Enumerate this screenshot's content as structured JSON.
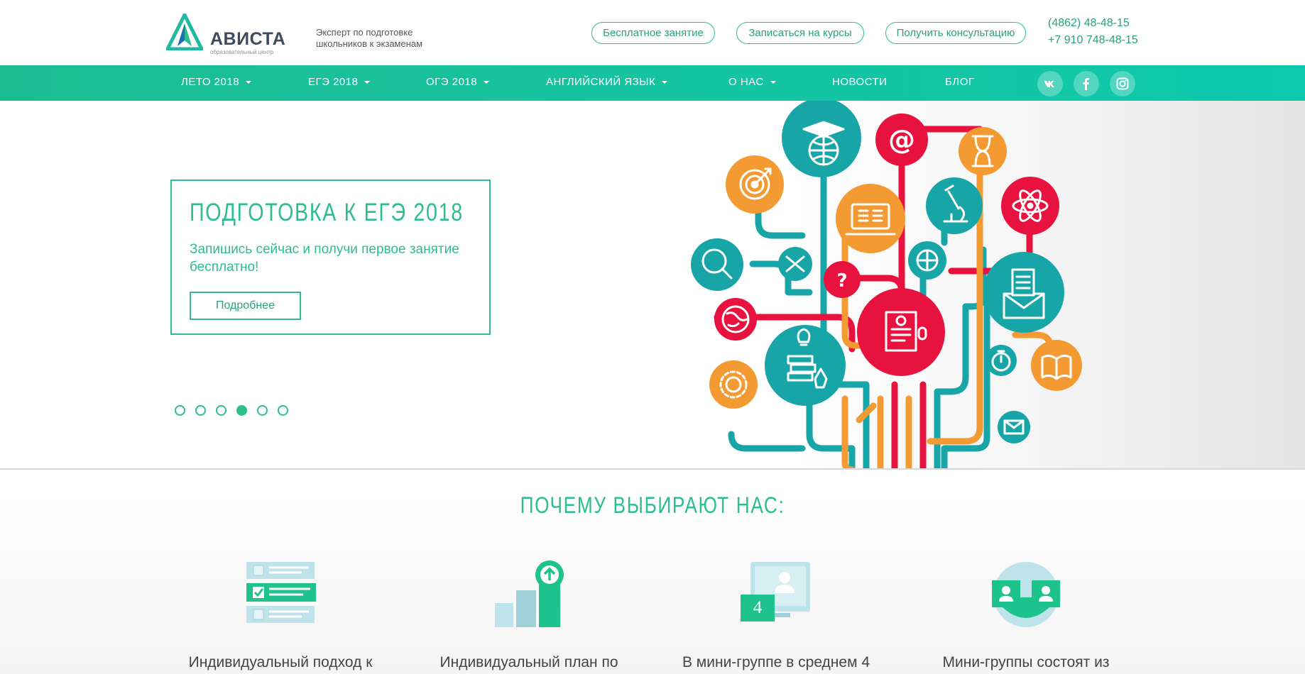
{
  "header": {
    "logo": {
      "name": "АВИСТА",
      "sub": "образовательный центр"
    },
    "tagline": "Эксперт по подготовке школьников к экзаменам",
    "buttons": {
      "free_lesson": "Бесплатное занятие",
      "enroll": "Записаться на курсы",
      "consult": "Получить консультацию"
    },
    "phones": [
      "(4862) 48-48-15",
      "+7 910 748-48-15"
    ]
  },
  "nav": {
    "items": [
      {
        "label": "ЛЕТО 2018",
        "dropdown": true
      },
      {
        "label": "ЕГЭ 2018",
        "dropdown": true
      },
      {
        "label": "ОГЭ 2018",
        "dropdown": true
      },
      {
        "label": "АНГЛИЙСКИЙ ЯЗЫК",
        "dropdown": true
      },
      {
        "label": "О НАС",
        "dropdown": true
      },
      {
        "label": "НОВОСТИ",
        "dropdown": false
      },
      {
        "label": "БЛОГ",
        "dropdown": false
      }
    ],
    "social": [
      "vk-icon",
      "facebook-icon",
      "instagram-icon"
    ]
  },
  "hero": {
    "title": "ПОДГОТОВКА К ЕГЭ 2018",
    "text": "Запишись сейчас и получи первое занятие бесплатно!",
    "button": "Подробнее",
    "slides_total": 6,
    "active_slide": 4
  },
  "why": {
    "title": "ПОЧЕМУ ВЫБИРАЮТ НАС:",
    "features": [
      {
        "icon": "checklist-icon",
        "text": "Индивидуальный подход к"
      },
      {
        "icon": "growth-chart-icon",
        "text": "Индивидуальный план по"
      },
      {
        "icon": "monitor-group-icon",
        "text": "В мини-группе в среднем 4",
        "badge": "4"
      },
      {
        "icon": "group-people-icon",
        "text": "Мини-группы состоят из"
      }
    ]
  },
  "colors": {
    "accent": "#2cbf8a",
    "nav_start": "#1dbd93",
    "nav_end": "#0ec9ad",
    "red": "#e8123f",
    "orange": "#f39a33",
    "teal": "#17a5a8"
  }
}
